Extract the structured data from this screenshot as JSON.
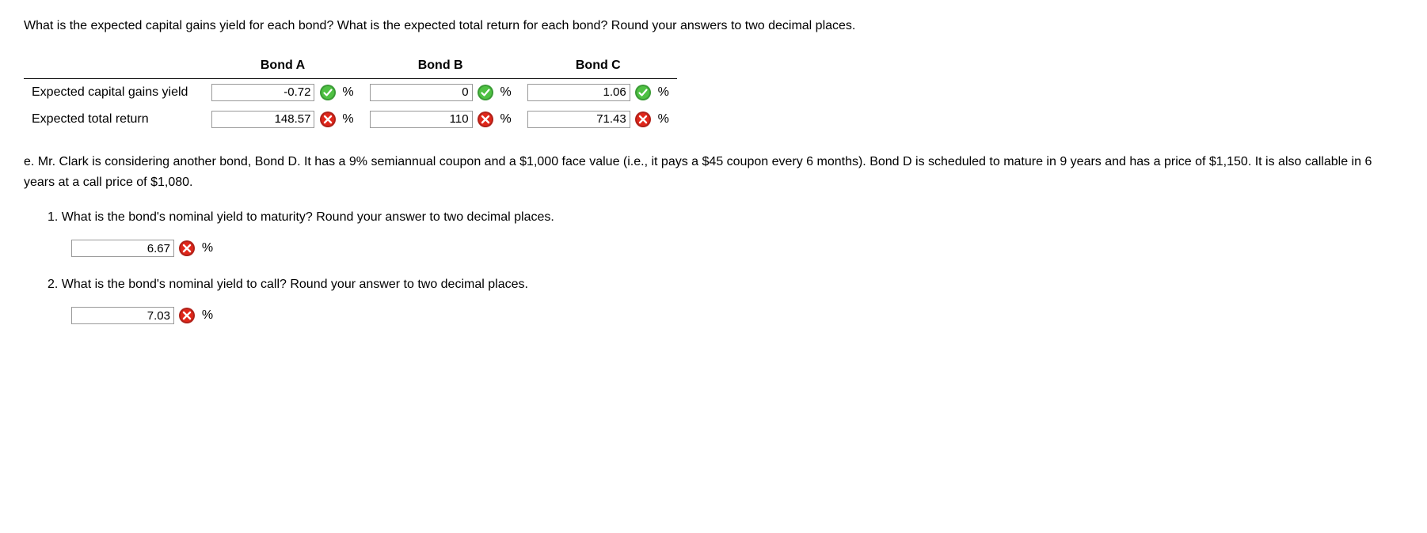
{
  "intro": "What is the expected capital gains yield for each bond? What is the expected total return for each bond? Round your answers to two decimal places.",
  "table": {
    "headers": [
      "",
      "Bond A",
      "Bond B",
      "Bond C"
    ],
    "rows": [
      {
        "label": "Expected capital gains yield",
        "cells": [
          {
            "value": "-0.72",
            "status": "correct",
            "unit": "%"
          },
          {
            "value": "0",
            "status": "correct",
            "unit": "%"
          },
          {
            "value": "1.06",
            "status": "correct",
            "unit": "%"
          }
        ]
      },
      {
        "label": "Expected total return",
        "cells": [
          {
            "value": "148.57",
            "status": "wrong",
            "unit": "%"
          },
          {
            "value": "110",
            "status": "wrong",
            "unit": "%"
          },
          {
            "value": "71.43",
            "status": "wrong",
            "unit": "%"
          }
        ]
      }
    ]
  },
  "part_e": {
    "label": "e.",
    "text": "Mr. Clark is considering another bond, Bond D. It has a 9% semiannual coupon and a $1,000 face value (i.e., it pays a $45 coupon every 6 months). Bond D is scheduled to mature in 9 years and has a price of $1,150. It is also callable in 6 years at a call price of $1,080.",
    "sub": [
      {
        "num": "1.",
        "q": "What is the bond's nominal yield to maturity? Round your answer to two decimal places.",
        "answer": {
          "value": "6.67",
          "status": "wrong",
          "unit": "%"
        }
      },
      {
        "num": "2.",
        "q": "What is the bond's nominal yield to call? Round your answer to two decimal places.",
        "answer": {
          "value": "7.03",
          "status": "wrong",
          "unit": "%"
        }
      }
    ]
  }
}
